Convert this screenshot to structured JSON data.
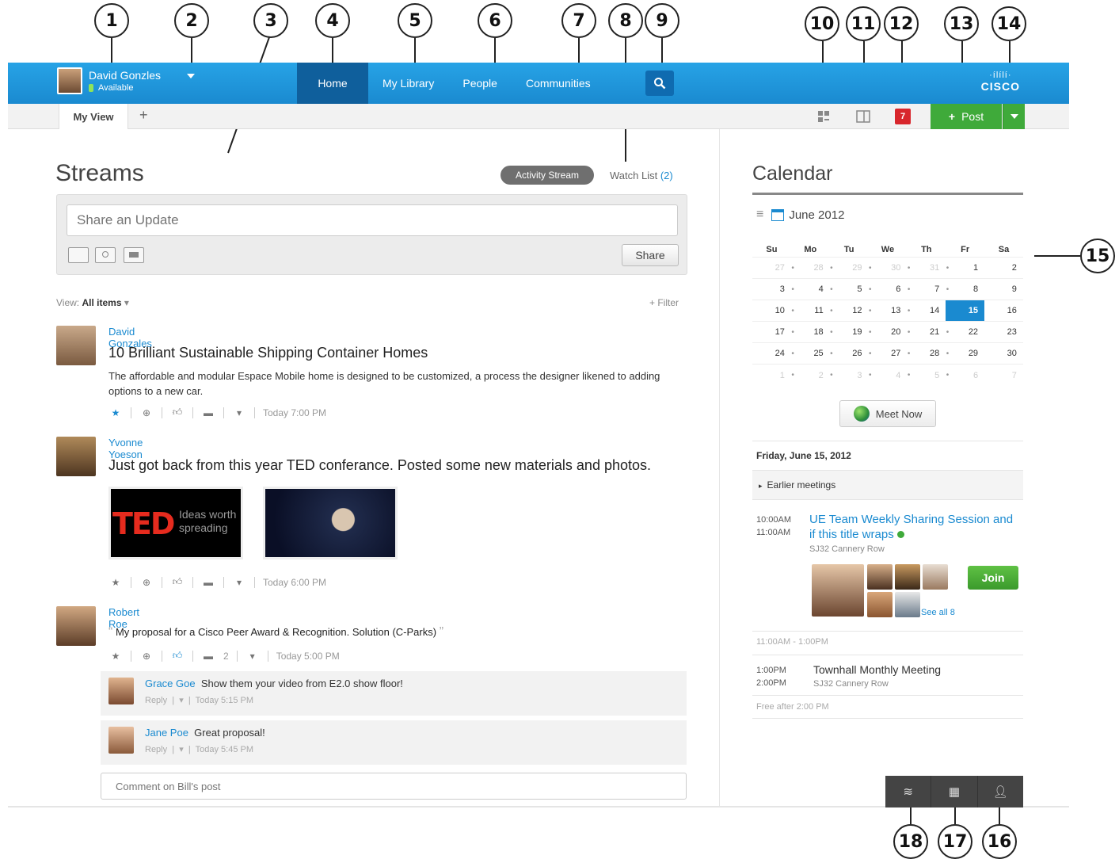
{
  "callouts": [
    "1",
    "2",
    "3",
    "4",
    "5",
    "6",
    "7",
    "8",
    "9",
    "10",
    "11",
    "12",
    "13",
    "14",
    "15",
    "16",
    "17",
    "18"
  ],
  "header": {
    "user_name": "David Gonzles",
    "user_status": "Available",
    "nav": [
      "Home",
      "My Library",
      "People",
      "Communities"
    ],
    "brand_bars": "·ílílí·",
    "brand_word": "CISCO"
  },
  "subbar": {
    "tab_label": "My View",
    "add_tab": "+",
    "notification_count": "7",
    "post_label": "Post"
  },
  "streams": {
    "title": "Streams",
    "activity_tab": "Activity Stream",
    "watch_label": "Watch List",
    "watch_count": "(2)",
    "share_placeholder": "Share an Update",
    "share_button": "Share",
    "view_label": "View:",
    "view_value": "All items",
    "filter_label": "+ Filter",
    "posts": [
      {
        "author": "David Gonzales",
        "title": "10 Brilliant Sustainable Shipping Container Homes",
        "body": "The affordable and modular Espace Mobile home is designed to be customized, a process the designer likened to adding options to a new car.",
        "time": "Today 7:00 PM"
      },
      {
        "author": "Yvonne Yoeson",
        "title": "Just got back from this year TED conferance. Posted some new materials and photos.",
        "ted_logo": "TED",
        "ted_tag1": "Ideas worth",
        "ted_tag2": "spreading",
        "time": "Today 6:00 PM"
      },
      {
        "author": "Robert Roe",
        "quote": "My proposal for a Cisco Peer Award & Recognition. Solution (C-Parks)",
        "comment_count": "2",
        "time": "Today 5:00 PM",
        "comments": [
          {
            "author": "Grace Goe",
            "text": "Show them your video from E2.0 show floor!",
            "reply": "Reply",
            "time": "Today 5:15 PM"
          },
          {
            "author": "Jane Poe",
            "text": "Great proposal!",
            "reply": "Reply",
            "time": "Today 5:45 PM"
          }
        ]
      }
    ],
    "comment_placeholder": "Comment on Bill's post"
  },
  "calendar": {
    "title": "Calendar",
    "month": "June 2012",
    "weekdays": [
      "Su",
      "Mo",
      "Tu",
      "We",
      "Th",
      "Fr",
      "Sa"
    ],
    "weeks": [
      [
        "27",
        "28",
        "29",
        "30",
        "31",
        "1",
        "2"
      ],
      [
        "3",
        "4",
        "5",
        "6",
        "7",
        "8",
        "9"
      ],
      [
        "10",
        "11",
        "12",
        "13",
        "14",
        "15",
        "16"
      ],
      [
        "17",
        "18",
        "19",
        "20",
        "21",
        "22",
        "23"
      ],
      [
        "24",
        "25",
        "26",
        "27",
        "28",
        "29",
        "30"
      ],
      [
        "1",
        "2",
        "3",
        "4",
        "5",
        "6",
        "7"
      ]
    ],
    "today": "15",
    "meet_now": "Meet Now",
    "agenda_date": "Friday, June 15, 2012",
    "earlier": "Earlier meetings",
    "event1": {
      "start": "10:00AM",
      "end": "11:00AM",
      "title": "UE Team Weekly Sharing Session and if this title wraps",
      "location": "SJ32 Cannery Row",
      "see_all": "See all 8",
      "join": "Join"
    },
    "free1": "11:00AM - 1:00PM",
    "event2": {
      "start": "1:00PM",
      "end": "2:00PM",
      "title": "Townhall Monthly Meeting",
      "location": "SJ32 Cannery Row"
    },
    "free2": "Free after 2:00 PM"
  },
  "colors": {
    "accent": "#1a8ad0",
    "nav_active": "#0f5f9c",
    "post_green": "#3faa3a",
    "badge_red": "#d8262c"
  }
}
